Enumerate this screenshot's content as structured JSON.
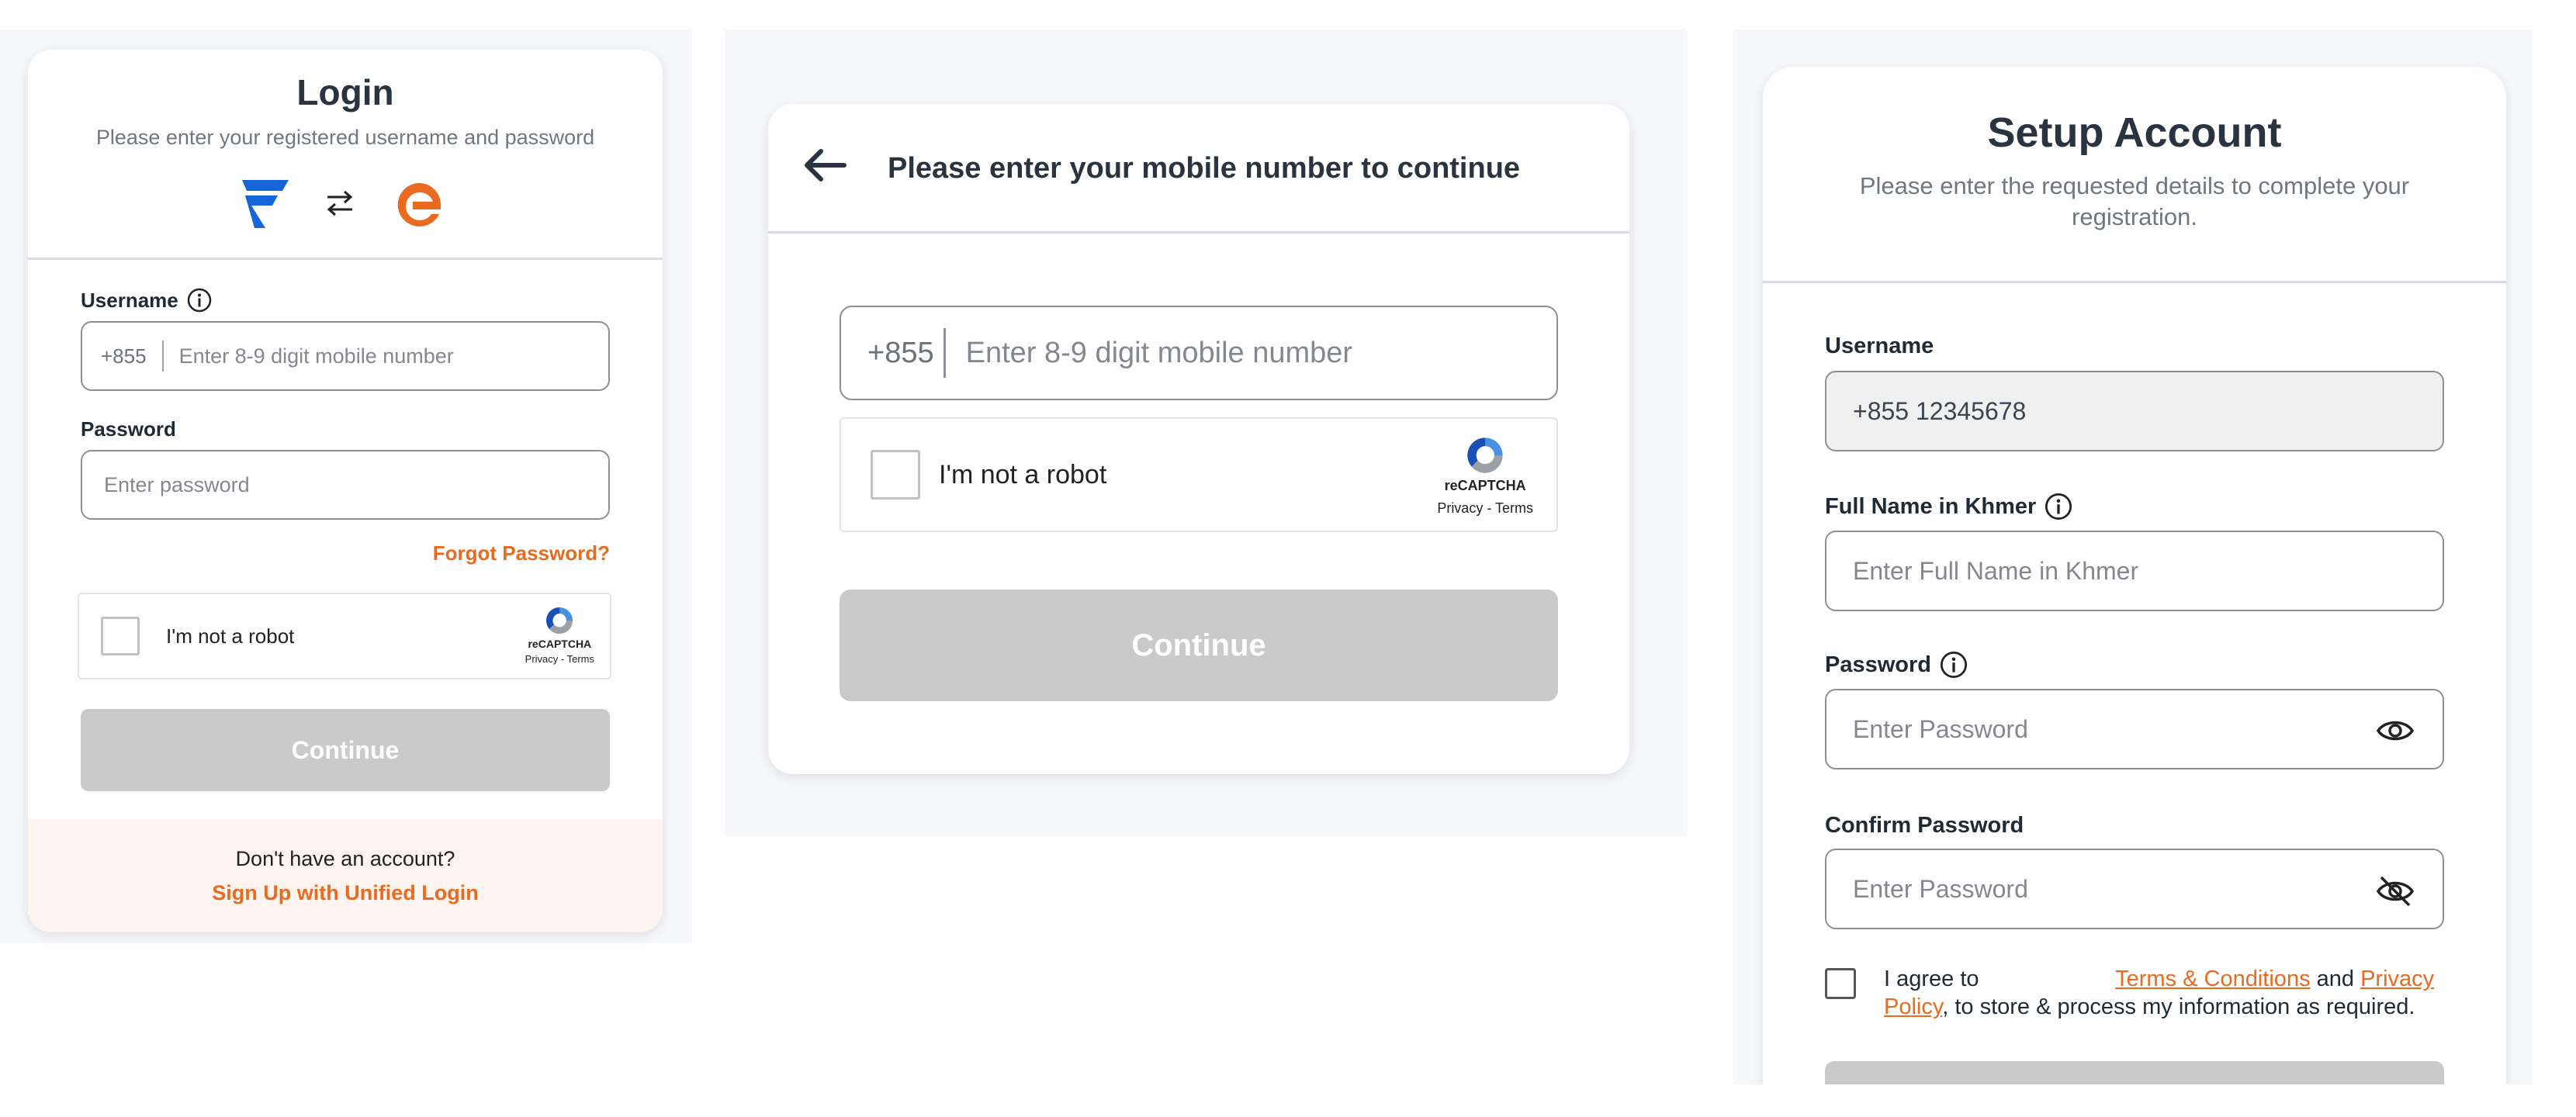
{
  "login": {
    "title": "Login",
    "subtitle": "Please enter your registered username and password",
    "swap_icon": "swap-arrows-icon",
    "username_label": "Username",
    "country_code": "+855",
    "username_placeholder": "Enter 8-9 digit mobile number",
    "password_label": "Password",
    "password_placeholder": "Enter password",
    "forgot": "Forgot Password?",
    "captcha_text": "I'm not a robot",
    "captcha_brand": "reCAPTCHA",
    "captcha_links": "Privacy - Terms",
    "continue": "Continue",
    "no_account": "Don't have an account?",
    "signup": "Sign Up with Unified Login"
  },
  "mobile": {
    "title": "Please enter your mobile number to continue",
    "country_code": "+855",
    "placeholder": "Enter 8-9 digit mobile number",
    "captcha_text": "I'm not a robot",
    "captcha_brand": "reCAPTCHA",
    "captcha_links": "Privacy - Terms",
    "continue": "Continue"
  },
  "setup": {
    "title": "Setup Account",
    "subtitle": "Please enter the requested details to complete your registration.",
    "username_label": "Username",
    "username_value": "+855 12345678",
    "fullname_label": "Full Name in Khmer",
    "fullname_placeholder": "Enter Full Name in Khmer",
    "password_label": "Password",
    "password_placeholder": "Enter Password",
    "confirm_label": "Confirm Password",
    "confirm_placeholder": "Enter Password",
    "agree_prefix": "I agree to",
    "terms": "Terms & Conditions",
    "and": "and",
    "privacy": "Privacy Policy",
    "agree_suffix": ", to store & process my information as required."
  },
  "colors": {
    "accent": "#ea6a1f",
    "brand_blue": "#1565d8",
    "disabled_button": "#cacaca",
    "panel_bg": "#f6f7fb",
    "footer_bg": "#fdf3ef"
  }
}
